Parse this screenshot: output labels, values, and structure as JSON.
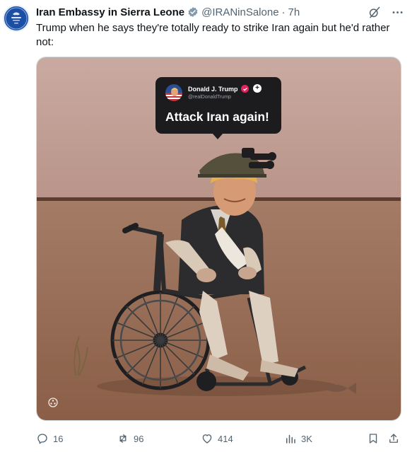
{
  "author": {
    "display_name": "Iran Embassy in Sierra Leone",
    "handle": "@IRANinSalone",
    "separator": "·",
    "timestamp": "7h",
    "avatar_icon": "embassy-emblem"
  },
  "post": {
    "text": "Trump when he says they're totally ready to strike Iran again but he'd rather not:"
  },
  "media": {
    "embedded_post": {
      "name": "Donald J. Trump",
      "handle": "@realDonaldTrump",
      "plus": "+",
      "text": "Attack Iran again!"
    }
  },
  "actions": {
    "replies": "16",
    "reposts": "96",
    "likes": "414",
    "views": "3K"
  },
  "colors": {
    "text_primary": "#0f1419",
    "text_secondary": "#536471",
    "verified_grey": "#829aab",
    "avatar_blue": "#1a4fa3"
  }
}
